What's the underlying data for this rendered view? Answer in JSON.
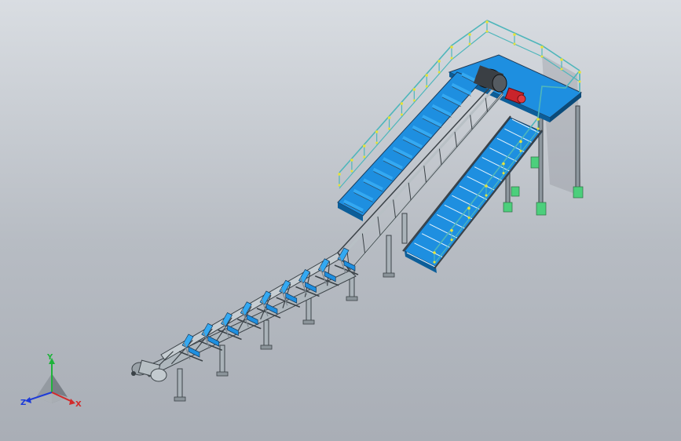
{
  "viewport": {
    "background_top": "#d9dde2",
    "background_bottom": "#a9aeb6"
  },
  "model": {
    "colors": {
      "steel": "#cfd5d9",
      "steel_dark": "#7d878e",
      "steel_edge": "#3b4247",
      "belt_blue": "#1e8fe0",
      "belt_light": "#34a9f2",
      "rail_cyan": "#4fb6bb",
      "rail_yellow": "#e8e23a",
      "pad_green": "#4ccf7c",
      "motor_red": "#c9242b",
      "pulley_dark": "#2b2f33"
    }
  },
  "triad": {
    "labels": {
      "y": "Y",
      "z": "Z",
      "x": "X"
    },
    "colors": {
      "y": "#1fb33b",
      "z": "#1d3bd8",
      "x": "#d22a2a"
    }
  }
}
